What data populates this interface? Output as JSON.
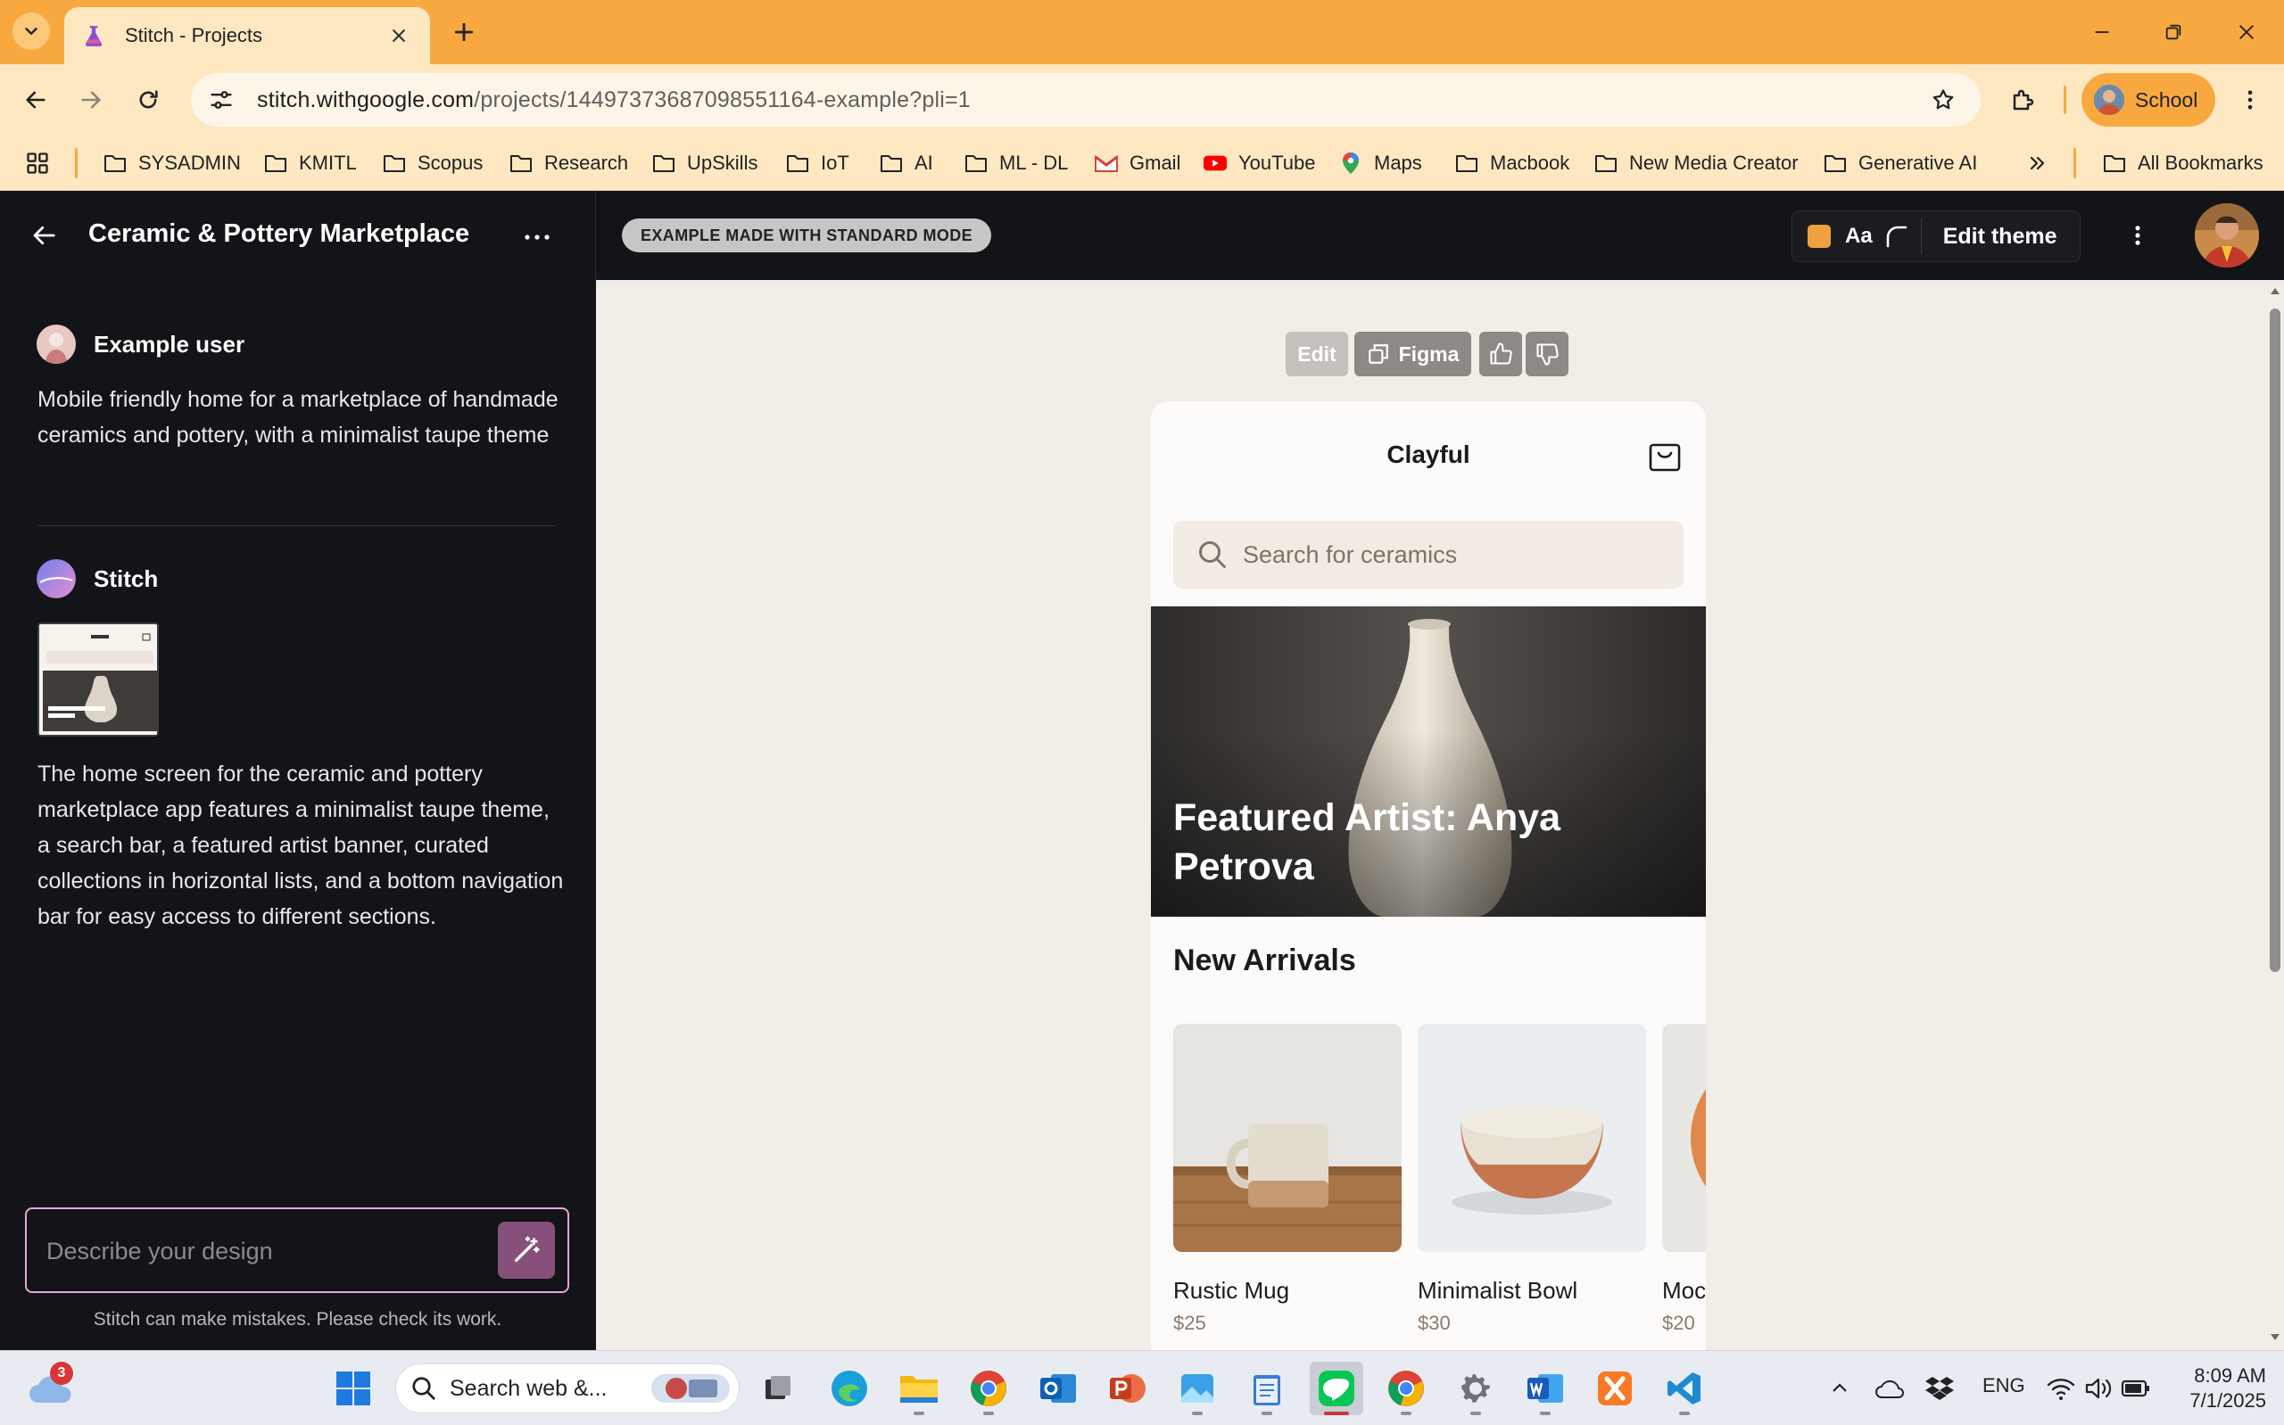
{
  "browser": {
    "tab_title": "Stitch - Projects",
    "url_host": "stitch.withgoogle.com",
    "url_path": "/projects/14497373687098551164-example?pli=1",
    "profile_name": "School",
    "bookmarks": [
      "SYSADMIN",
      "KMITL",
      "Scopus",
      "Research",
      "UpSkills",
      "IoT",
      "AI",
      "ML - DL",
      "Gmail",
      "YouTube",
      "Maps",
      "Macbook",
      "New Media Creator",
      "Generative AI"
    ],
    "all_bookmarks": "All Bookmarks"
  },
  "app": {
    "project_title": "Ceramic & Pottery Marketplace",
    "mode_badge": "EXAMPLE MADE WITH STANDARD MODE",
    "theme_font": "Aa",
    "edit_theme": "Edit theme",
    "accent": "#f0a040"
  },
  "chat": {
    "user_name": "Example user",
    "user_message": "Mobile friendly home for a marketplace of handmade ceramics and pottery, with a minimalist taupe theme",
    "bot_name": "Stitch",
    "bot_message": "The home screen for the ceramic and pottery marketplace app features a minimalist taupe theme, a search bar, a featured artist banner, curated collections in horizontal lists, and a bottom navigation bar for easy access to different sections.",
    "input_placeholder": "Describe your design",
    "disclaimer": "Stitch can make mistakes. Please check its work."
  },
  "canvas_toolbar": {
    "edit": "Edit",
    "figma": "Figma"
  },
  "mockup": {
    "brand": "Clayful",
    "search_placeholder": "Search for ceramics",
    "hero_text": "Featured Artist: Anya Petrova",
    "section_title": "New Arrivals",
    "products": [
      {
        "name": "Rustic Mug",
        "price": "$25"
      },
      {
        "name": "Minimalist Bowl",
        "price": "$30"
      },
      {
        "name": "Moc",
        "price": "$20"
      }
    ]
  },
  "taskbar": {
    "search": "Search web &...",
    "notification_count": "3",
    "lang": "ENG",
    "time": "8:09 AM",
    "date": "7/1/2025"
  }
}
